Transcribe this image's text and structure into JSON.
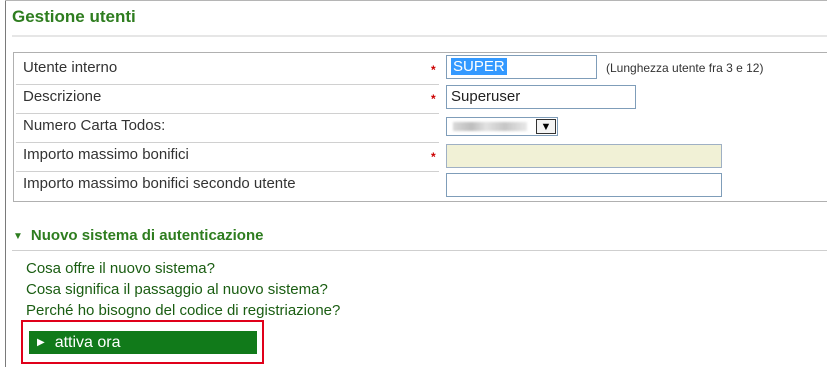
{
  "page": {
    "title": "Gestione utenti"
  },
  "form": {
    "rows": [
      {
        "label": "Utente interno",
        "required": true,
        "value": "SUPER",
        "hint": "(Lunghezza utente fra 3 e 12)"
      },
      {
        "label": "Descrizione",
        "required": true,
        "value": "Superuser"
      },
      {
        "label": "Numero Carta Todos:",
        "required": false,
        "value": ""
      },
      {
        "label": "Importo massimo bonifici",
        "required": true,
        "value": ""
      },
      {
        "label": "Importo massimo bonifici secondo utente",
        "required": false,
        "value": ""
      }
    ],
    "required_mark": "*"
  },
  "auth_section": {
    "title": "Nuovo sistema di autenticazione",
    "links": [
      "Cosa offre il nuovo sistema?",
      "Cosa significa il passaggio al nuovo sistema?",
      "Perché ho bisogno del codice di registriazione?"
    ],
    "cta_label": "attiva ora"
  },
  "colors": {
    "heading_green": "#2e7d1f",
    "cta_green": "#117a1a",
    "highlight_red": "#e0001a",
    "required_red": "#cc0000"
  }
}
